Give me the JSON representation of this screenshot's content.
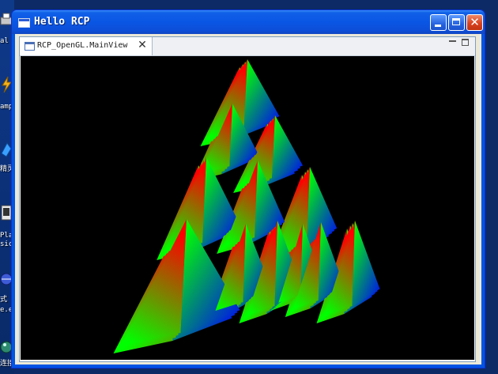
{
  "desktop": {
    "icons": [
      {
        "name": "printer-icon",
        "line1": "al l",
        "line2": ""
      },
      {
        "name": "winamp-icon",
        "line1": "amp",
        "line2": ""
      },
      {
        "name": "shortcut-icon",
        "line1": "精灵",
        "line2": ""
      },
      {
        "name": "media-player-icon",
        "line1": "Play",
        "line2": "sic"
      },
      {
        "name": "program-icon",
        "line1": "式",
        "line2": "e.e"
      },
      {
        "name": "network-icon",
        "line1": "连接",
        "line2": ""
      }
    ]
  },
  "window": {
    "title": "Hello RCP",
    "buttons": {
      "minimize": "minimize-icon",
      "maximize": "maximize-icon",
      "close": "close-icon"
    }
  },
  "view": {
    "tab_label": "RCP_OpenGL.MainView",
    "tab_close": "✕",
    "scene": "sierpinski-pyramid",
    "colors": {
      "red": "#ff0000",
      "green": "#00ff00",
      "blue": "#0000ff",
      "background": "#000000"
    }
  }
}
